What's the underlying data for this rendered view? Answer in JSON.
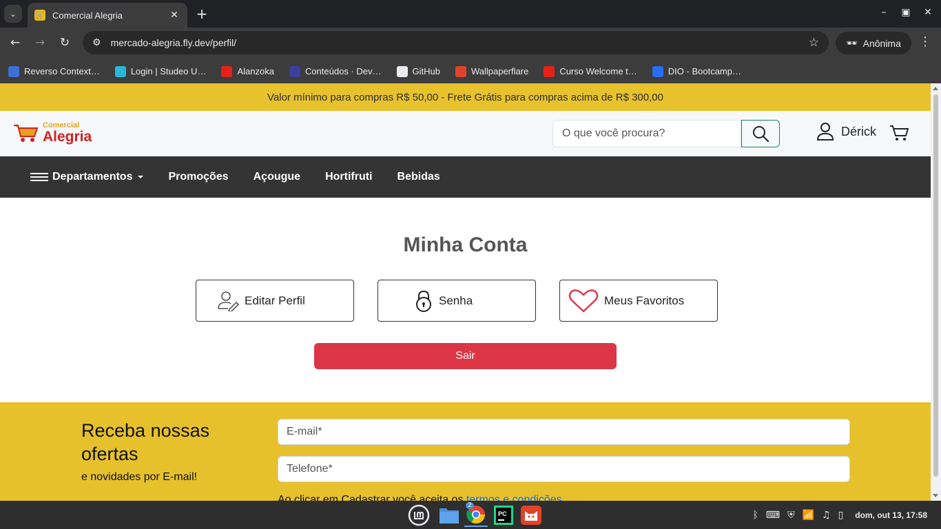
{
  "browser": {
    "tab_title": "Comercial Alegria",
    "url": "mercado-alegria.fly.dev/perfil/",
    "profile_label": "Anônima",
    "bookmarks": [
      {
        "label": "Reverso Context…",
        "color": "#3b6fd6"
      },
      {
        "label": "Login | Studeo U…",
        "color": "#2bb6d8"
      },
      {
        "label": "Alanzoka",
        "color": "#e62117"
      },
      {
        "label": "Conteúdos · Dev…",
        "color": "#3a3f9a"
      },
      {
        "label": "GitHub",
        "color": "#e8eaed"
      },
      {
        "label": "Wallpaperflare",
        "color": "#e0432a"
      },
      {
        "label": "Curso Welcome t…",
        "color": "#e62117"
      },
      {
        "label": "DIO - Bootcamp…",
        "color": "#2a6df0"
      }
    ]
  },
  "site": {
    "promo": "Valor mínimo para compras R$ 50,00 - Frete Grátis para compras acima de R$ 300,00",
    "logo_small": "Comercial",
    "logo_big": "Alegria",
    "search_placeholder": "O que você procura?",
    "user_name": "Dérick",
    "nav": {
      "departments": "Departamentos",
      "items": [
        "Promoções",
        "Açougue",
        "Hortifruti",
        "Bebidas"
      ]
    },
    "account": {
      "title": "Minha Conta",
      "edit_profile": "Editar Perfil",
      "password": "Senha",
      "favorites": "Meus Favoritos",
      "logout": "Sair"
    },
    "newsletter": {
      "title": "Receba nossas ofertas",
      "subtitle": "e novidades por E-mail!",
      "email_placeholder": "E-mail*",
      "phone_placeholder": "Telefone*",
      "terms_text": "Ao clicar em Cadastrar você aceita os ",
      "terms_link": "termos e condições"
    }
  },
  "taskbar": {
    "chrome_badge": "2",
    "clock": "dom, out 13, 17:58"
  },
  "colors": {
    "brand_yellow": "#e7c22c",
    "nav_dark": "#343434",
    "danger": "#dc3545",
    "search_green": "#198754"
  }
}
